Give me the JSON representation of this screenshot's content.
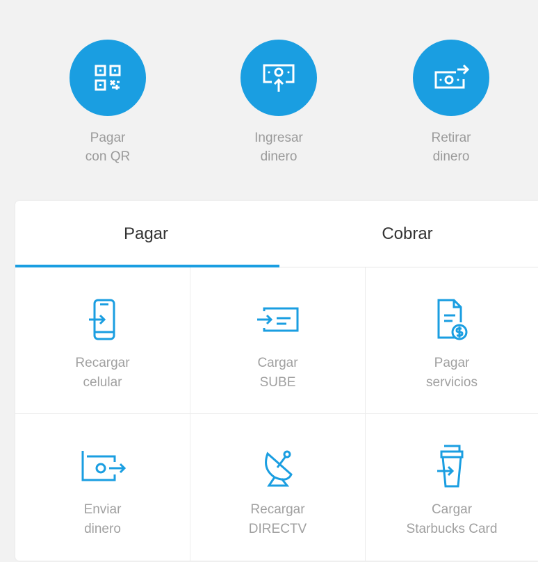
{
  "quick_actions": [
    {
      "label": "Pagar\ncon QR",
      "icon": "qr-code-icon"
    },
    {
      "label": "Ingresar\ndinero",
      "icon": "deposit-money-icon"
    },
    {
      "label": "Retirar\ndinero",
      "icon": "withdraw-money-icon"
    }
  ],
  "tabs": [
    {
      "label": "Pagar",
      "active": true
    },
    {
      "label": "Cobrar",
      "active": false
    }
  ],
  "services": [
    {
      "label": "Recargar\ncelular",
      "icon": "phone-recharge-icon"
    },
    {
      "label": "Cargar\nSUBE",
      "icon": "sube-card-icon"
    },
    {
      "label": "Pagar\nservicios",
      "icon": "bill-payment-icon"
    },
    {
      "label": "Enviar\ndinero",
      "icon": "send-money-icon"
    },
    {
      "label": "Recargar\nDIRECTV",
      "icon": "satellite-dish-icon"
    },
    {
      "label": "Cargar\nStarbucks Card",
      "icon": "coffee-cup-icon"
    }
  ],
  "colors": {
    "accent": "#1a9ee1",
    "background": "#f2f2f2",
    "muted_text": "#9a9a9a"
  }
}
